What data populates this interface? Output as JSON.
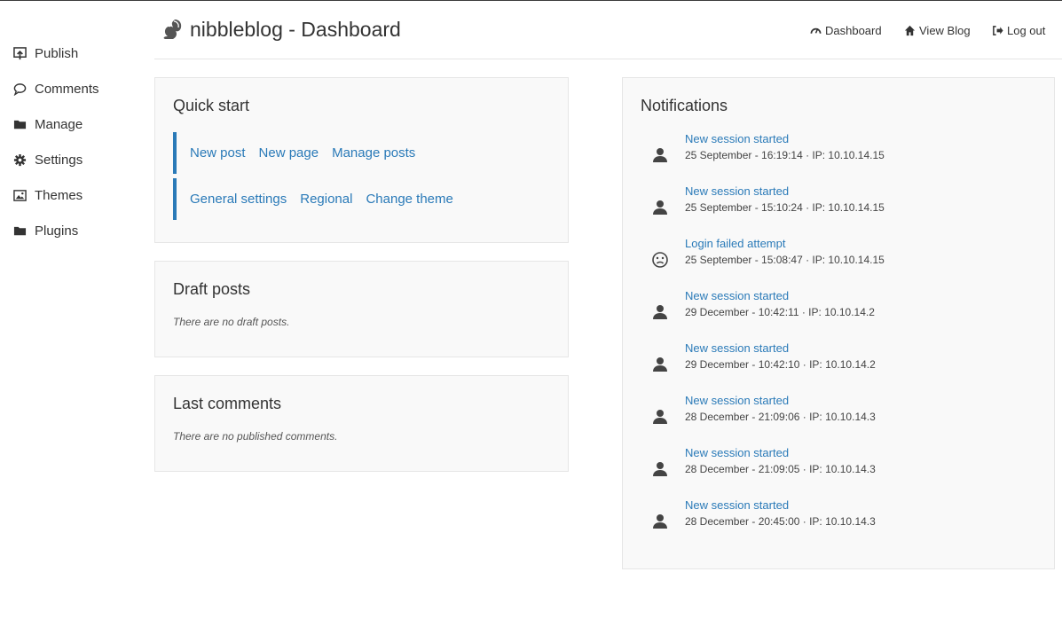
{
  "header": {
    "title": "nibbleblog - Dashboard",
    "nav": [
      {
        "label": "Dashboard",
        "icon": "dashboard-gauge-icon"
      },
      {
        "label": "View Blog",
        "icon": "home-icon"
      },
      {
        "label": "Log out",
        "icon": "logout-icon"
      }
    ]
  },
  "sidebar": {
    "items": [
      {
        "label": "Publish",
        "icon": "publish-upload-icon"
      },
      {
        "label": "Comments",
        "icon": "comment-bubble-icon"
      },
      {
        "label": "Manage",
        "icon": "folder-icon"
      },
      {
        "label": "Settings",
        "icon": "gear-icon"
      },
      {
        "label": "Themes",
        "icon": "image-icon"
      },
      {
        "label": "Plugins",
        "icon": "folder-icon"
      }
    ]
  },
  "quick_start": {
    "title": "Quick start",
    "row1": [
      "New post",
      "New page",
      "Manage posts"
    ],
    "row2": [
      "General settings",
      "Regional",
      "Change theme"
    ]
  },
  "draft_posts": {
    "title": "Draft posts",
    "empty": "There are no draft posts."
  },
  "last_comments": {
    "title": "Last comments",
    "empty": "There are no published comments."
  },
  "notifications": {
    "title": "Notifications",
    "items": [
      {
        "title": "New session started",
        "detail": "25 September - 16:19:14 · IP: 10.10.14.15",
        "icon": "user-icon"
      },
      {
        "title": "New session started",
        "detail": "25 September - 15:10:24 · IP: 10.10.14.15",
        "icon": "user-icon"
      },
      {
        "title": "Login failed attempt",
        "detail": "25 September - 15:08:47 · IP: 10.10.14.15",
        "icon": "sad-face-icon"
      },
      {
        "title": "New session started",
        "detail": "29 December - 10:42:11 · IP: 10.10.14.2",
        "icon": "user-icon"
      },
      {
        "title": "New session started",
        "detail": "29 December - 10:42:10 · IP: 10.10.14.2",
        "icon": "user-icon"
      },
      {
        "title": "New session started",
        "detail": "28 December - 21:09:06 · IP: 10.10.14.3",
        "icon": "user-icon"
      },
      {
        "title": "New session started",
        "detail": "28 December - 21:09:05 · IP: 10.10.14.3",
        "icon": "user-icon"
      },
      {
        "title": "New session started",
        "detail": "28 December - 20:45:00 · IP: 10.10.14.3",
        "icon": "user-icon"
      }
    ]
  },
  "colors": {
    "link": "#2a7ab8",
    "accent_bar": "#2a7ab8",
    "panel_bg": "#f9f9f9"
  }
}
